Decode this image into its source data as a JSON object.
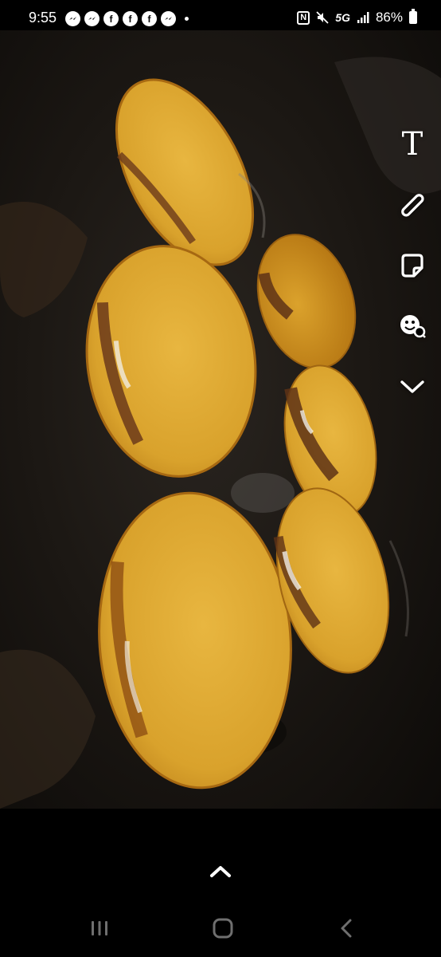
{
  "status_bar": {
    "time": "9:55",
    "notifications": [
      "messenger-icon",
      "messenger-icon",
      "facebook-icon",
      "facebook-icon",
      "facebook-icon",
      "messenger-icon"
    ],
    "network": "5G",
    "battery": "86%"
  },
  "photo": {
    "subject": "photo-tacos-on-griddle"
  },
  "tools": [
    {
      "name": "text-tool",
      "icon": "text-icon",
      "glyph": "T"
    },
    {
      "name": "draw-tool",
      "icon": "pencil-icon"
    },
    {
      "name": "sticker-tool",
      "icon": "sticker-icon"
    },
    {
      "name": "emoji-tool",
      "icon": "emoji-icon"
    },
    {
      "name": "more-tools",
      "icon": "chevron-down-icon"
    }
  ],
  "navigation": {
    "swipe": "chevron-up-icon",
    "recents": "recents-icon",
    "home": "home-icon",
    "back": "back-icon"
  }
}
